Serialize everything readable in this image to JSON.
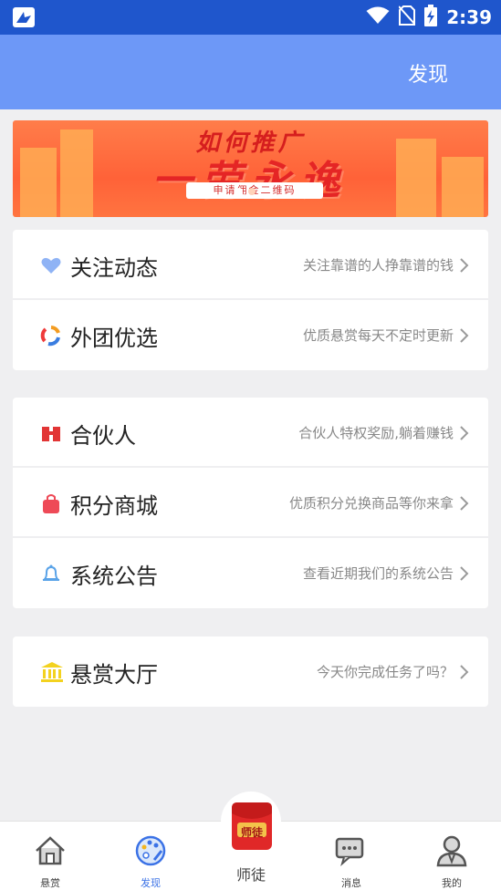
{
  "status_bar": {
    "time": "2:39"
  },
  "header": {
    "title": "发现"
  },
  "banner": {
    "headline_top": "如何推广",
    "headline_main": "一劳永逸",
    "subtext": "申请佣金二维码",
    "active_slide": 1,
    "slide_count": 2
  },
  "groups": [
    {
      "items": [
        {
          "label": "关注动态",
          "desc": "关注靠谱的人挣靠谱的钱",
          "icon": "heart-icon",
          "color": "#8fb3f5"
        },
        {
          "label": "外团优选",
          "desc": "优质悬赏每天不定时更新",
          "icon": "ring-icon",
          "color": "#f39c21"
        }
      ]
    },
    {
      "items": [
        {
          "label": "合伙人",
          "desc": "合伙人特权奖励,躺着赚钱",
          "icon": "partner-icon",
          "color": "#e23535"
        },
        {
          "label": "积分商城",
          "desc": "优质积分兑换商品等你来拿",
          "icon": "shopping-bag-icon",
          "color": "#ee4a57"
        },
        {
          "label": "系统公告",
          "desc": "查看近期我们的系统公告",
          "icon": "bell-icon",
          "color": "#5aa3e8"
        }
      ]
    },
    {
      "items": [
        {
          "label": "悬赏大厅",
          "desc": "今天你完成任务了吗？",
          "icon": "bank-icon",
          "color": "#f3d21f"
        }
      ]
    }
  ],
  "tabbar": {
    "tabs": [
      {
        "label": "悬赏",
        "icon": "home-icon",
        "active": false
      },
      {
        "label": "发现",
        "icon": "palette-icon",
        "active": true
      },
      {
        "label": "师徒",
        "icon": "red-packet-icon",
        "active": false
      },
      {
        "label": "消息",
        "icon": "chat-icon",
        "active": false
      },
      {
        "label": "我的",
        "icon": "user-icon",
        "active": false
      }
    ],
    "center_badge_text": "师徒"
  },
  "colors": {
    "primary": "#6d98f7",
    "status_bar": "#1f56cc",
    "active_tab": "#3b72e6"
  }
}
